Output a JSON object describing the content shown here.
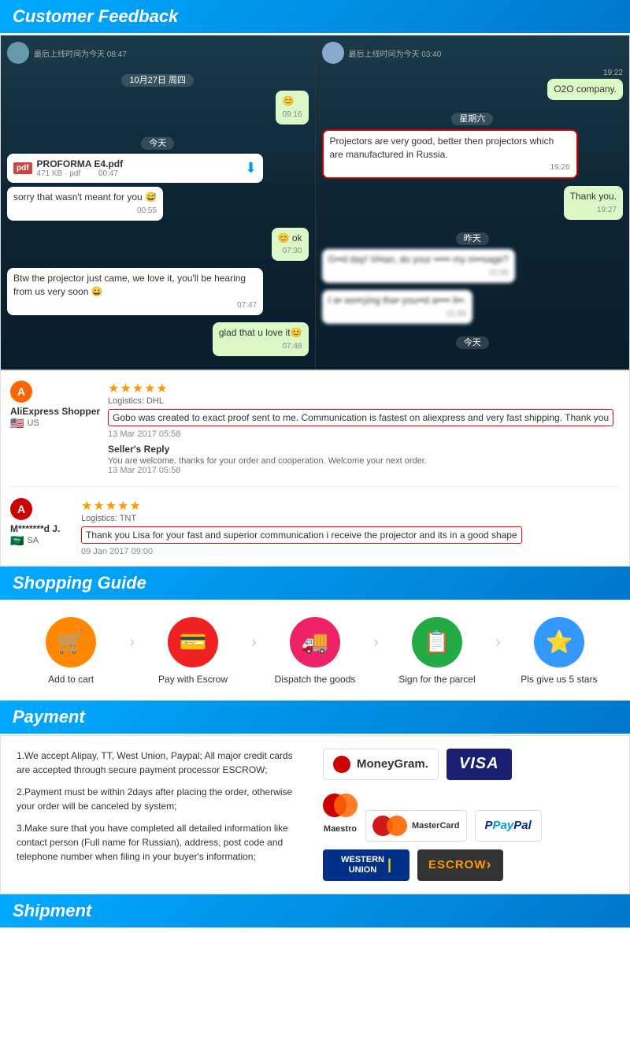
{
  "customerFeedback": {
    "title": "Customer Feedback",
    "chat1": {
      "header": "最后上线时间为今天 08:47",
      "date1": "10月27日 周四",
      "time1": "09:16",
      "time1check": "✓",
      "today1": "今天",
      "fileName": "PROFORMA E4.pdf",
      "fileSize": "471 KB · pdf",
      "fileDuration": "00:47",
      "msg1": "sorry that wasn't meant for you 😅",
      "msg1time": "00:55",
      "msg2": "😊 ok",
      "msg2time": "07:30",
      "msg3": "Btw the projector just came, we love it, you'll be hearing from us very soon 😀",
      "msg3time": "07:47",
      "msg4": "glad that u love it😊",
      "msg4time": "07:48"
    },
    "chat2": {
      "header": "最后上线时间为今天 03:40",
      "time1": "19:22",
      "msg1": "O2O company.",
      "weekday": "星期六",
      "msg2": "Projectors are very good, better then projectors which are manufactured in Russia.",
      "msg2time": "19:26",
      "msg3": "Thank you.",
      "msg3time": "19:27",
      "yesterday": "昨天",
      "msg4blurred": "G••d day! Vi•ian, do your ••••• my m••sage?",
      "msg4time": "21:55",
      "msg5blurred": "I a• wo•rying tha• you••d a•••• li••.",
      "msg5time": "21:56",
      "today2": "今天"
    }
  },
  "reviews": [
    {
      "badgeLetter": "A",
      "badgeClass": "badge-orange",
      "shopperName": "AliExpress Shopper",
      "flag": "🇺🇸",
      "country": "US",
      "stars": "★★★★★",
      "logistics": "Logistics: DHL",
      "reviewText": "Gobo was created to exact proof sent to me. Communication is fastest on aliexpress and very fast shipping. Thank you",
      "date": "13 Mar 2017 05:58",
      "sellerReply": "Seller's Reply",
      "replyText": "You are welcome. thanks for your order and cooperation. Welcome your next order.",
      "replyDate": "13 Mar 2017 05:58"
    },
    {
      "badgeLetter": "A",
      "badgeClass": "badge-red",
      "shopperName": "M*******d J.",
      "flag": "🇸🇦",
      "country": "SA",
      "stars": "★★★★★",
      "logistics": "Logistics: TNT",
      "reviewText": "Thank you Lisa for your fast and superior communication i receive the projector and its in a good shape",
      "date": "09 Jan 2017 09:00",
      "sellerReply": null,
      "replyText": null,
      "replyDate": null
    }
  ],
  "shoppingGuide": {
    "title": "Shopping Guide",
    "steps": [
      {
        "icon": "🛒",
        "colorClass": "icon-orange",
        "label": "Add to cart"
      },
      {
        "icon": "💳",
        "colorClass": "icon-red",
        "label": "Pay with Escrow"
      },
      {
        "icon": "🚚",
        "colorClass": "icon-pink",
        "label": "Dispatch the goods"
      },
      {
        "icon": "📋",
        "colorClass": "icon-green",
        "label": "Sign for the parcel"
      },
      {
        "icon": "⭐",
        "colorClass": "icon-blue",
        "label": "Pls give us 5 stars"
      }
    ]
  },
  "payment": {
    "title": "Payment",
    "points": [
      "1.We accept Alipay, TT, West Union, Paypal; All major credit cards are accepted through secure payment processor ESCROW;",
      "2.Payment must be within 2days after placing the order, otherwise your order will be canceled by system;",
      "3.Make sure that you have completed all detailed information like contact person (Full name for Russian), address, post code and telephone number when filing in your buyer's information;"
    ],
    "logos": {
      "row1": [
        "MoneyGram.",
        "VISA"
      ],
      "row2": [
        "Maestro",
        "MasterCard",
        "PayPal"
      ],
      "row3": [
        "WESTERN UNION",
        "ESCROW"
      ]
    }
  },
  "shipment": {
    "title": "Shipment"
  }
}
